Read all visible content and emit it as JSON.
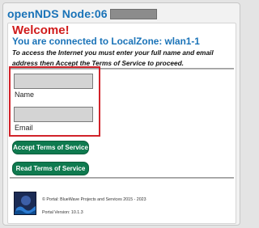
{
  "header": {
    "title": "openNDS Node:06"
  },
  "content": {
    "welcome": "Welcome!",
    "connected": "You are connected to LocalZone: wlan1-1",
    "instructions": "To access the Internet you must enter your full name and email address then Accept the Terms of Service to proceed."
  },
  "form": {
    "name_label": "Name",
    "name_value": "",
    "email_label": "Email",
    "email_value": ""
  },
  "buttons": {
    "accept": "Accept Terms of Service",
    "read": "Read Terms of Service"
  },
  "footer": {
    "copyright": "© Portal: BlueWave Projects and Services 2015 - 2023",
    "version": "Portal Version: 10.1.3"
  },
  "colors": {
    "title_blue": "#1a73b8",
    "welcome_red": "#d01b1b",
    "highlight_red": "#d1232a",
    "button_green": "#0f7a4f"
  }
}
